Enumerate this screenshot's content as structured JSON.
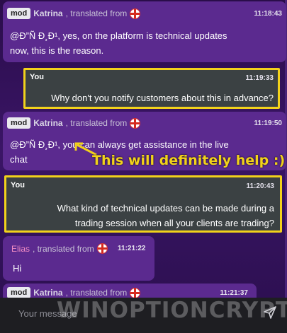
{
  "messages": [
    {
      "badge": "mod",
      "name": "Katrina",
      "suffix": ", translated from",
      "time": "11:18:43",
      "lines": [
        "@Ð”Ñ    Ð¸Ð¹, yes, on the platform is technical updates",
        "now, this is the reason."
      ]
    },
    {
      "sender": "You",
      "time": "11:19:33",
      "lines": [
        "Why don't you notify customers about this in advance?"
      ]
    },
    {
      "badge": "mod",
      "name": "Katrina",
      "suffix": ", translated from",
      "time": "11:19:50",
      "lines": [
        "@Ð”Ñ    Ð¸Ð¹, you can always get assistance in the live",
        "chat"
      ]
    },
    {
      "sender": "You",
      "time": "11:20:43",
      "lines": [
        "What kind of technical updates can be made during a",
        "trading session when all your clients are trading?"
      ]
    },
    {
      "name": "Elias",
      "suffix": ", translated from",
      "time": "11:21:22",
      "lines": [
        "Hi"
      ]
    },
    {
      "badge": "mod",
      "name": "Katrina",
      "suffix": ", translated from",
      "time": "11:21:37"
    }
  ],
  "annotation": "This will definitely help :)",
  "input": {
    "placeholder": "Your message"
  },
  "watermark": "WINOPTIONCRYPTO.COM",
  "colors": {
    "highlight": "#f2d21b",
    "bubble": "#5b2a8f",
    "own_bubble": "#3b4143"
  },
  "icons": {
    "flag": "uk-flag-icon",
    "send": "send-icon"
  }
}
